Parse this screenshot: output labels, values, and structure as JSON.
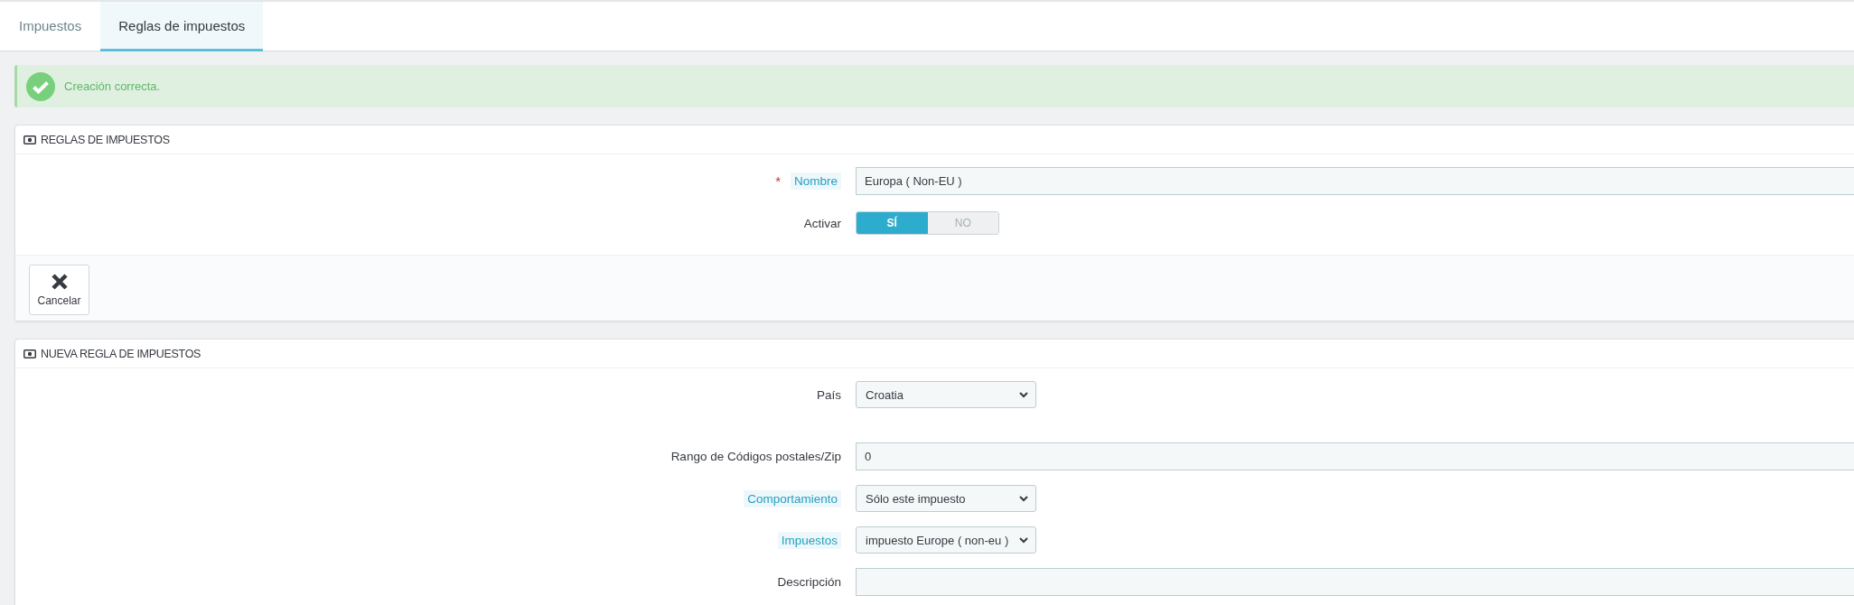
{
  "tabs": [
    {
      "label": "Impuestos",
      "selected": false
    },
    {
      "label": "Reglas de impuestos",
      "selected": true
    }
  ],
  "alert": {
    "kind": "success",
    "message": "Creación correcta."
  },
  "panels": [
    {
      "title": "REGLAS DE IMPUESTOS",
      "fields": [
        {
          "kind": "text",
          "required_mark": "*",
          "label": "Nombre",
          "help": true,
          "value": "Europa ( Non-EU )"
        },
        {
          "kind": "toggle",
          "label": "Activar",
          "help": false,
          "options": [
            {
              "label": "SÍ",
              "selected": true
            },
            {
              "label": "NO",
              "selected": false
            }
          ]
        }
      ],
      "footer_buttons": [
        {
          "label": "Cancelar"
        }
      ]
    },
    {
      "title": "NUEVA REGLA DE IMPUESTOS",
      "fields": [
        {
          "kind": "select",
          "label": "País",
          "help": false,
          "value": "Croatia"
        },
        {
          "kind": "text",
          "label": "Rango de Códigos postales/Zip",
          "help": false,
          "value": "0"
        },
        {
          "kind": "select",
          "label": "Comportamiento",
          "help": true,
          "value": "Sólo este impuesto"
        },
        {
          "kind": "select",
          "label": "Impuestos",
          "help": true,
          "value": "impuesto Europe ( non-eu )"
        },
        {
          "kind": "text",
          "label": "Descripción",
          "help": false
        }
      ]
    }
  ]
}
